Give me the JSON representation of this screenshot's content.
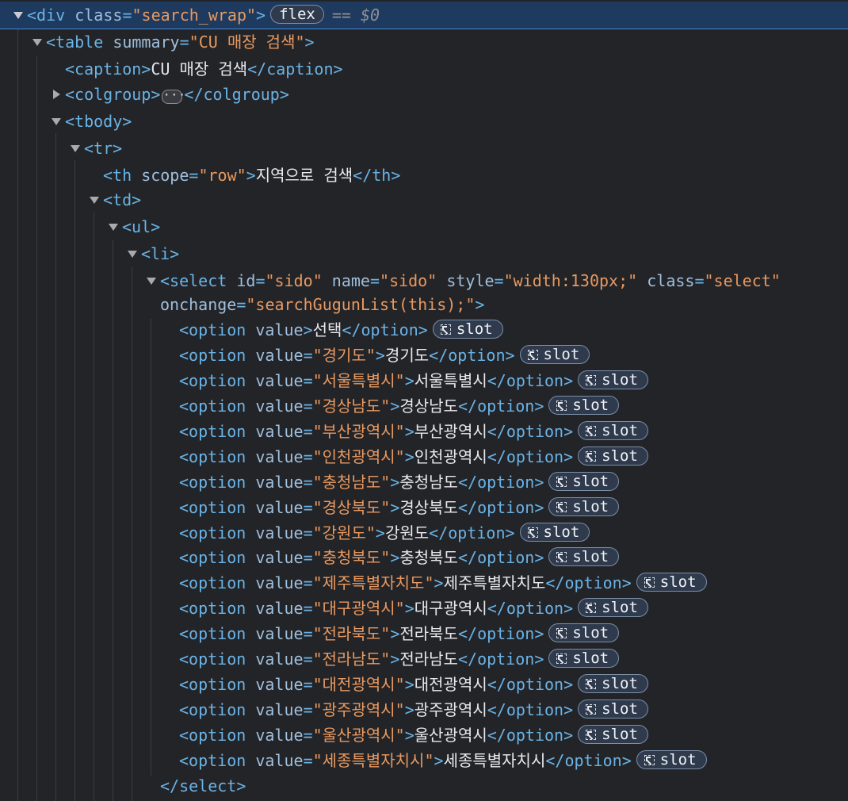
{
  "nodes": {
    "div": {
      "tag": "div",
      "attr": "class",
      "value": "search_wrap",
      "badge": "flex",
      "console_ref": "== $0"
    },
    "table": {
      "tag": "table",
      "attr": "summary",
      "value": "CU 매장 검색"
    },
    "caption": {
      "open": "<caption>",
      "text": "CU 매장 검색",
      "close": "</caption>"
    },
    "colgroup": {
      "open": "<colgroup>",
      "ellipsis": "···",
      "close": "</colgroup>"
    },
    "tbody": {
      "open": "<tbody>"
    },
    "tr": {
      "open": "<tr>"
    },
    "th": {
      "tag": "th",
      "attr": "scope",
      "value": "row",
      "text": "지역으로 검색",
      "close": "</th>"
    },
    "td": {
      "open": "<td>"
    },
    "ul": {
      "open": "<ul>"
    },
    "li": {
      "open": "<li>"
    },
    "select": {
      "tag": "select",
      "id_attr": "id",
      "id": "sido",
      "name_attr": "name",
      "name": "sido",
      "style_attr": "style",
      "style": "width:130px;",
      "class_attr": "class",
      "class": "select",
      "onchange_attr": "onchange",
      "onchange": "searchGugunList(this);",
      "close": "</select>"
    }
  },
  "option_tag": "option",
  "option_attr": "value",
  "slot_label": "slot",
  "options": [
    {
      "value": null,
      "text": "선택"
    },
    {
      "value": "경기도",
      "text": "경기도"
    },
    {
      "value": "서울특별시",
      "text": "서울특별시"
    },
    {
      "value": "경상남도",
      "text": "경상남도"
    },
    {
      "value": "부산광역시",
      "text": "부산광역시"
    },
    {
      "value": "인천광역시",
      "text": "인천광역시"
    },
    {
      "value": "충청남도",
      "text": "충청남도"
    },
    {
      "value": "경상북도",
      "text": "경상북도"
    },
    {
      "value": "강원도",
      "text": "강원도"
    },
    {
      "value": "충청북도",
      "text": "충청북도"
    },
    {
      "value": "제주특별자치도",
      "text": "제주특별자치도"
    },
    {
      "value": "대구광역시",
      "text": "대구광역시"
    },
    {
      "value": "전라북도",
      "text": "전라북도"
    },
    {
      "value": "전라남도",
      "text": "전라남도"
    },
    {
      "value": "대전광역시",
      "text": "대전광역시"
    },
    {
      "value": "광주광역시",
      "text": "광주광역시"
    },
    {
      "value": "울산광역시",
      "text": "울산광역시"
    },
    {
      "value": "세종특별자치시",
      "text": "세종특별자치시"
    }
  ],
  "colors": {
    "background": "#232428",
    "selection": "#1e3a5f",
    "tag": "#6ab3e6",
    "attribute": "#9fbfdd",
    "value": "#e89960",
    "text": "#e8e8ee"
  }
}
